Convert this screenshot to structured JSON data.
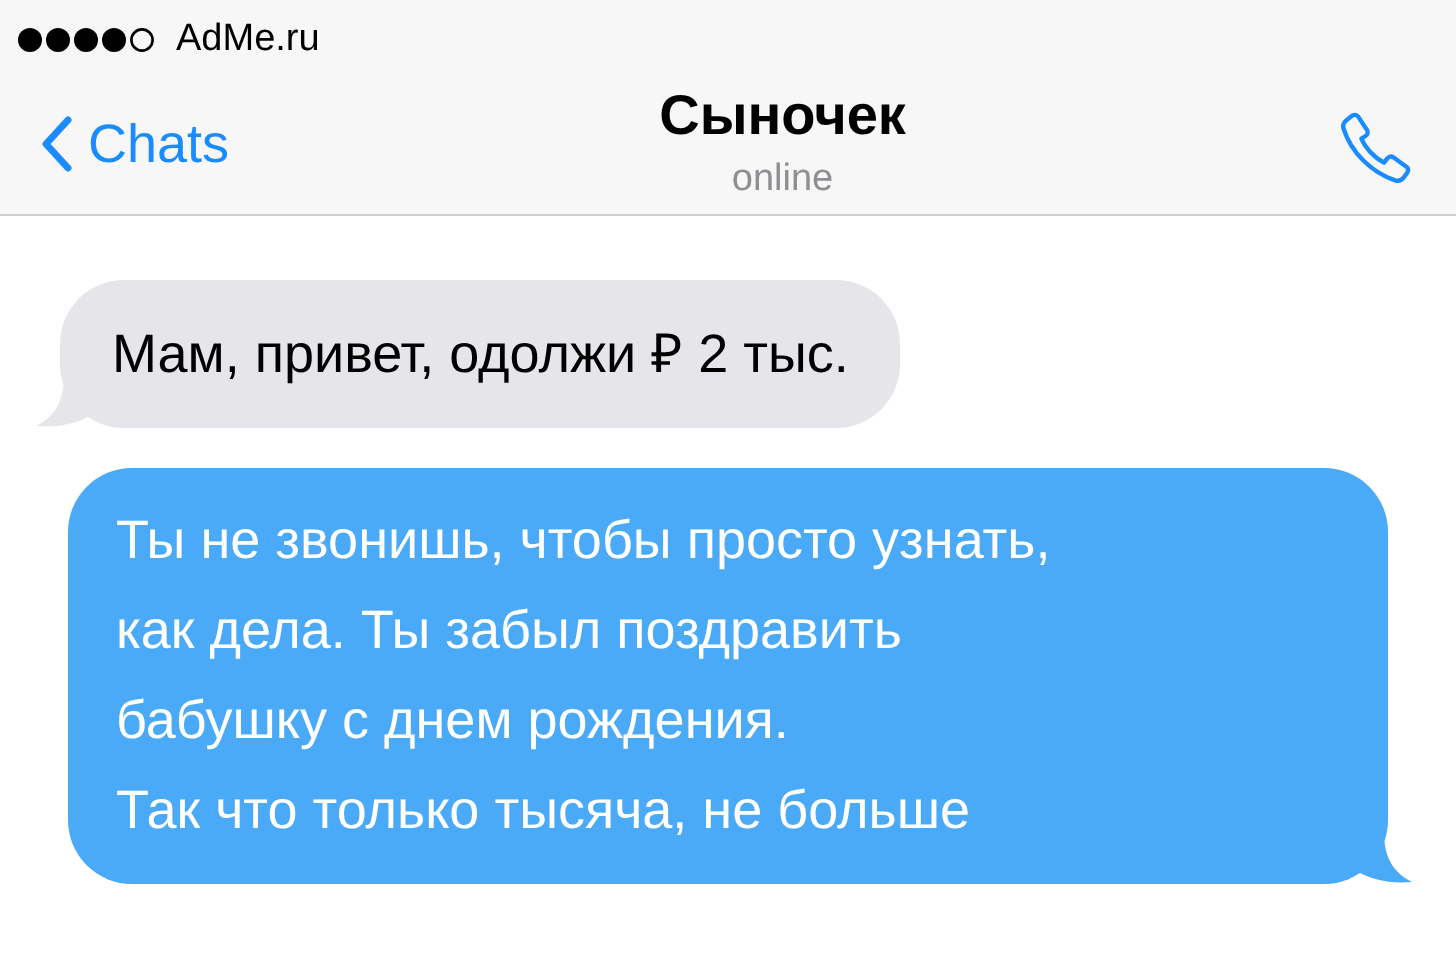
{
  "status_bar": {
    "carrier": "AdMe.ru"
  },
  "header": {
    "back_label": "Chats",
    "title": "Сыночек",
    "subtitle": "online"
  },
  "messages": [
    {
      "kind": "incoming",
      "text": "Мам, привет, одолжи ₽ 2 тыс."
    },
    {
      "kind": "outgoing",
      "text": "Ты не звонишь, чтобы просто узнать,\nкак дела. Ты забыл поздравить\nбабушку с днем рождения.\nТак что только тысяча, не больше"
    }
  ]
}
